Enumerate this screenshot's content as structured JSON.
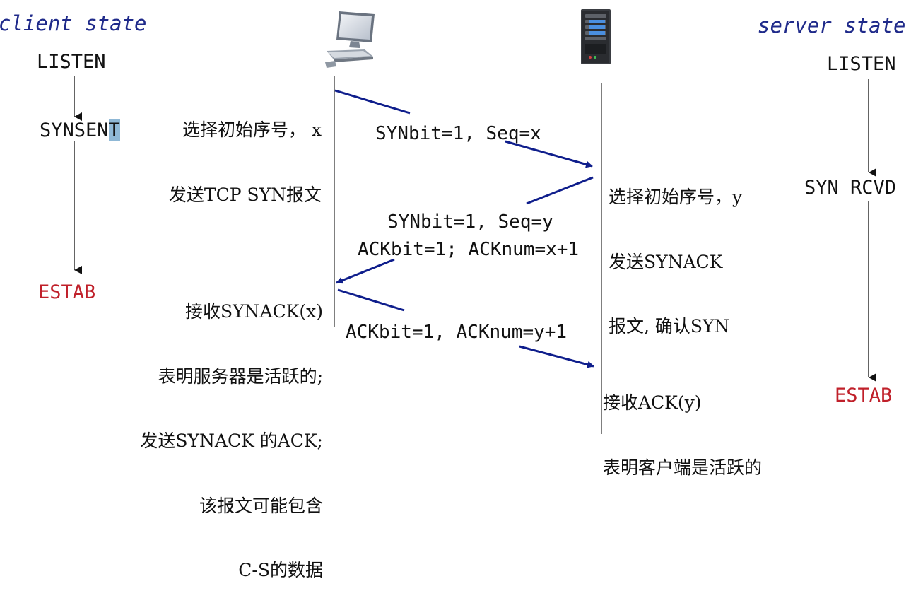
{
  "client": {
    "title": "client state",
    "states": {
      "listen": "LISTEN",
      "synsent_head": "SYNSEN",
      "synsent_tail": "T",
      "estab": "ESTAB"
    },
    "note_1": [
      "选择初始序号， x",
      "发送TCP SYN报文"
    ],
    "note_2": [
      "接收SYNACK(x)",
      "表明服务器是活跃的;",
      "发送SYNACK 的ACK;",
      "该报文可能包含",
      "C-S的数据"
    ]
  },
  "server": {
    "title": "server state",
    "states": {
      "listen": "LISTEN",
      "syn_rcvd": "SYN RCVD",
      "estab": "ESTAB"
    },
    "note_1": [
      "选择初始序号，y",
      "发送SYNACK",
      "报文, 确认SYN"
    ],
    "note_2": [
      "接收ACK(y)",
      "表明客户端是活跃的"
    ]
  },
  "messages": {
    "syn": "SYNbit=1, Seq=x",
    "synack_1": "SYNbit=1, Seq=y",
    "synack_2": "ACKbit=1; ACKnum=x+1",
    "ack": "ACKbit=1, ACKnum=y+1"
  },
  "icons": {
    "client": "desktop-computer-icon",
    "server": "server-tower-icon"
  },
  "colors": {
    "arrow": "#0f1e8c",
    "estab": "#c0202a",
    "title": "#1f2a8a",
    "highlight": "#8fb8d6"
  }
}
